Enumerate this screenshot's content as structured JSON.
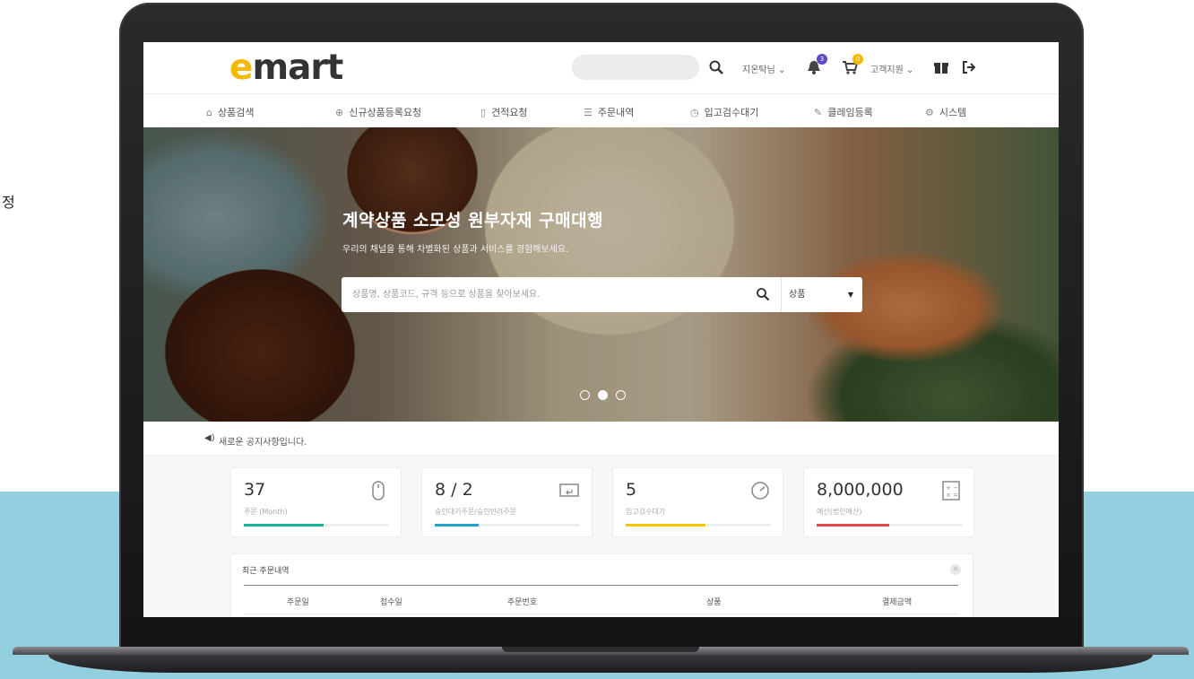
{
  "side_text": "정",
  "header": {
    "logo": "emart",
    "user_menu": "지온탁님 ⌄",
    "support_menu": "고객지원 ⌄",
    "notification_count": "3",
    "cart_count": "0"
  },
  "nav": {
    "items": [
      {
        "icon": "bag-icon",
        "glyph": "⌂",
        "label": "상품검색"
      },
      {
        "icon": "plus-circle-icon",
        "glyph": "⊕",
        "label": "신규상품등록요청"
      },
      {
        "icon": "document-icon",
        "glyph": "▯",
        "label": "견적요청"
      },
      {
        "icon": "list-icon",
        "glyph": "☰",
        "label": "주문내역"
      },
      {
        "icon": "clock-icon",
        "glyph": "◷",
        "label": "입고검수대기"
      },
      {
        "icon": "edit-icon",
        "glyph": "✎",
        "label": "클레임등록"
      },
      {
        "icon": "gear-icon",
        "glyph": "⚙",
        "label": "시스템"
      }
    ]
  },
  "hero": {
    "title": "계약상품 소모성 원부자재 구매대행",
    "subtitle": "우리의 채널을 통해 차별화된 상품과 서비스를 경험해보세요.",
    "search_placeholder": "상품명, 상품코드, 규격 등으로 상품을 찾아보세요.",
    "search_scope": "상품",
    "slides": 3,
    "active_slide": 2
  },
  "notice": {
    "text": "새로운 공지사항입니다."
  },
  "stats": [
    {
      "value": "37",
      "label": "주문 (Month)",
      "icon": "mouse-icon",
      "color": "#1bb39a",
      "progress": 0.55
    },
    {
      "value": "8 / 2",
      "label": "승인대기주문/승인반려주문",
      "icon": "return-icon",
      "color": "#1fa3c9",
      "progress": 0.3
    },
    {
      "value": "5",
      "label": "입고검수대기",
      "icon": "gauge-icon",
      "color": "#f5c400",
      "progress": 0.55
    },
    {
      "value": "8,000,000",
      "label": "예산(법인예산)",
      "icon": "calculator-icon",
      "color": "#e8474b",
      "progress": 0.5
    }
  ],
  "orders": {
    "title": "최근 주문내역",
    "columns": [
      "주문일",
      "접수일",
      "주문번호",
      "상품",
      "결제금액"
    ]
  },
  "colors": {
    "brand_yellow": "#f5b800",
    "background_band": "#94cfdf"
  }
}
